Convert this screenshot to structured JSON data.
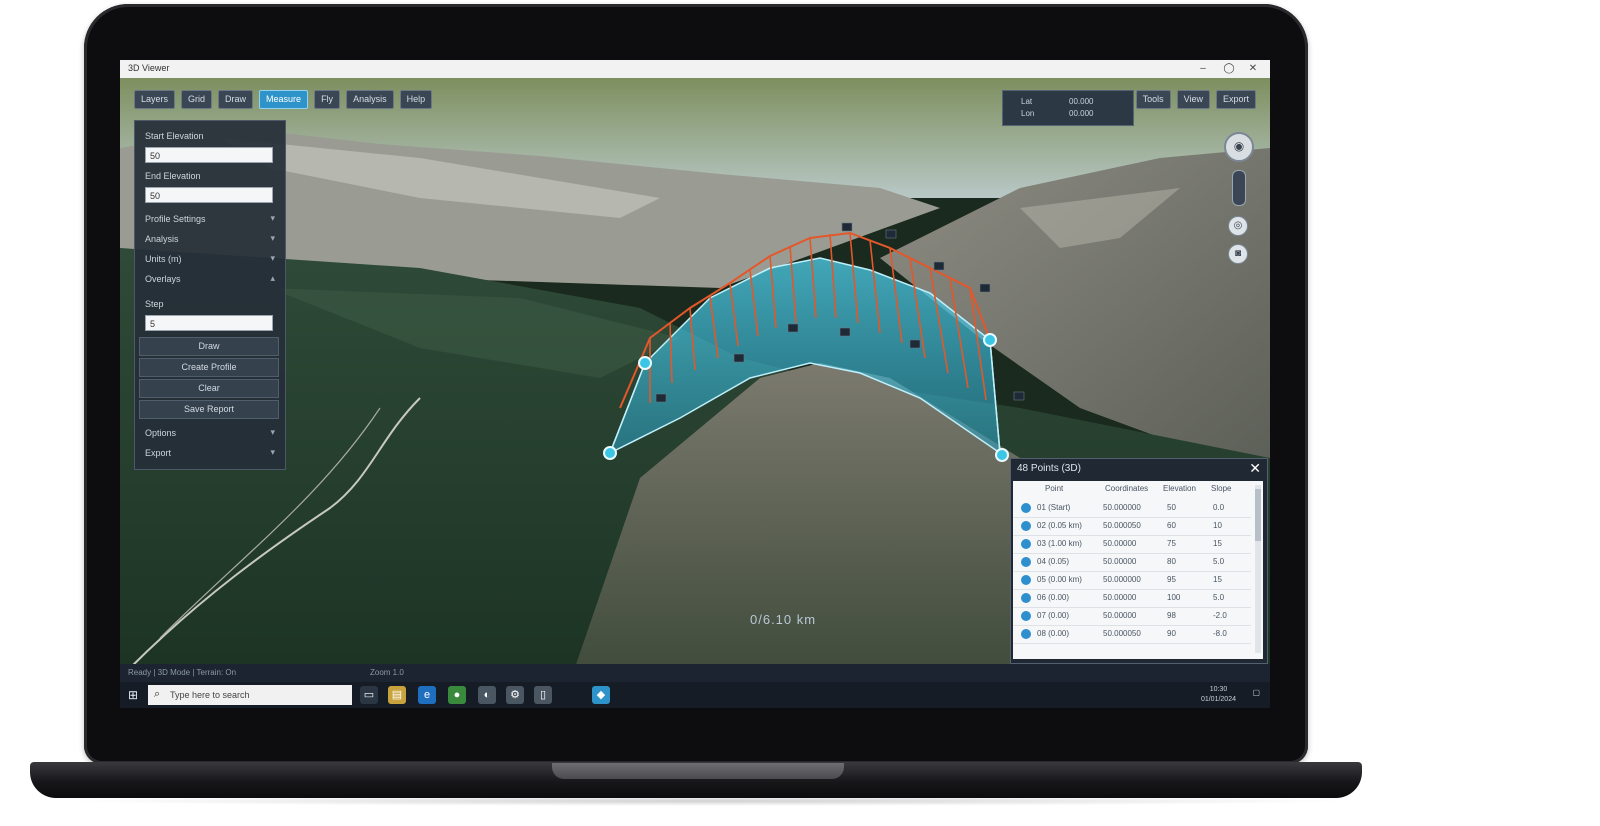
{
  "window": {
    "title": "3D Viewer",
    "controls": [
      "–",
      "◯",
      "✕"
    ]
  },
  "toolbar": {
    "buttons": [
      {
        "label": "Layers",
        "active": false
      },
      {
        "label": "Grid",
        "active": false
      },
      {
        "label": "Draw",
        "active": false
      },
      {
        "label": "Measure",
        "active": true
      },
      {
        "label": "Fly",
        "active": false
      },
      {
        "label": "Analysis",
        "active": false
      },
      {
        "label": "Help",
        "active": false
      }
    ],
    "right_buttons": [
      "Tools",
      "View",
      "Export"
    ]
  },
  "coords": {
    "lat_label": "Lat",
    "lat_value": "00.000",
    "lon_label": "Lon",
    "lon_value": "00.000"
  },
  "left_panel": {
    "field1_label": "Start Elevation",
    "field1_value": "50",
    "field2_label": "End Elevation",
    "field2_value": "50",
    "sections": [
      "Profile Settings",
      "Analysis",
      "Units (m)",
      "Overlays"
    ],
    "field3_label": "Step",
    "field3_value": "5",
    "buttons": [
      "Draw",
      "Create Profile",
      "Clear",
      "Save Report"
    ],
    "bottom_sections": [
      "Options",
      "Export"
    ]
  },
  "map": {
    "distance_label": "0/6.10 km"
  },
  "data_panel": {
    "title": "48 Points (3D)",
    "columns": [
      "Point",
      "Coordinates",
      "Elevation",
      "Slope"
    ],
    "rows": [
      {
        "point": "01 (Start)",
        "coords": "50.000000",
        "elev": "50",
        "slope": "0.0"
      },
      {
        "point": "02 (0.05 km)",
        "coords": "50.000050",
        "elev": "60",
        "slope": "10"
      },
      {
        "point": "03 (1.00 km)",
        "coords": "50.00000",
        "elev": "75",
        "slope": "15"
      },
      {
        "point": "04 (0.05)",
        "coords": "50.00000",
        "elev": "80",
        "slope": "5.0"
      },
      {
        "point": "05 (0.00 km)",
        "coords": "50.000000",
        "elev": "95",
        "slope": "15"
      },
      {
        "point": "06 (0.00)",
        "coords": "50.00000",
        "elev": "100",
        "slope": "5.0"
      },
      {
        "point": "07 (0.00)",
        "coords": "50.00000",
        "elev": "98",
        "slope": "-2.0"
      },
      {
        "point": "08 (0.00)",
        "coords": "50.000050",
        "elev": "90",
        "slope": "-8.0"
      }
    ]
  },
  "statusbar": {
    "left": "Ready  |  3D Mode  |  Terrain: On",
    "right": "Zoom 1.0"
  },
  "taskbar": {
    "search_placeholder": "Type here to search",
    "clock_time": "10:30",
    "clock_date": "01/01/2024"
  },
  "colors": {
    "accent": "#2e93c9",
    "profile_orange": "#e2582a",
    "profile_cyan": "#3cc6e6"
  }
}
